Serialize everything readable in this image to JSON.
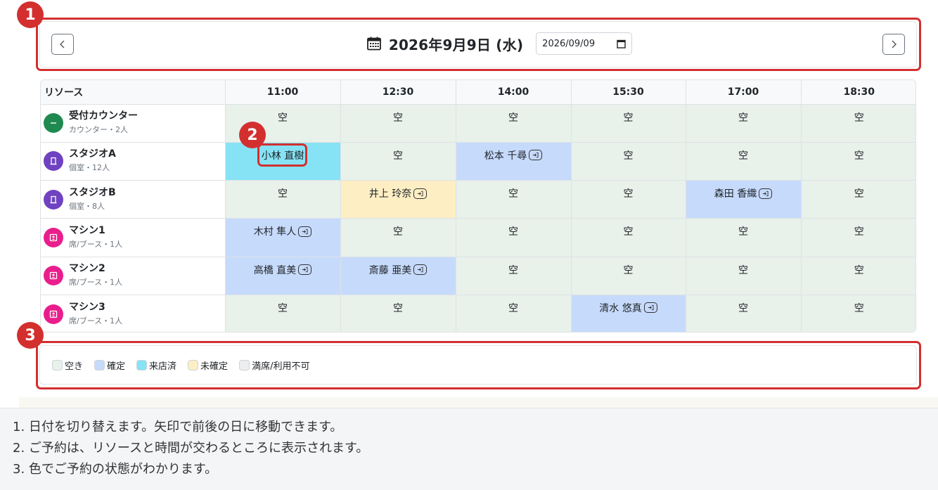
{
  "annotations": [
    "1",
    "2",
    "3"
  ],
  "header": {
    "date_title": "2026年9月9日 (水)",
    "date_value": "2026/09/09"
  },
  "table": {
    "resource_header": "リソース",
    "times": [
      "11:00",
      "12:30",
      "14:00",
      "15:30",
      "17:00",
      "18:30"
    ],
    "rows": [
      {
        "name": "受付カウンター",
        "sub": "カウンター・2人",
        "icon": "counter-icon",
        "color": "#1e8a50",
        "cells": [
          {
            "text": "空",
            "status": "empty"
          },
          {
            "text": "空",
            "status": "empty"
          },
          {
            "text": "空",
            "status": "empty"
          },
          {
            "text": "空",
            "status": "empty"
          },
          {
            "text": "空",
            "status": "empty"
          },
          {
            "text": "空",
            "status": "empty"
          }
        ]
      },
      {
        "name": "スタジオA",
        "sub": "個室・12人",
        "icon": "door-icon",
        "color": "#6f42c1",
        "cells": [
          {
            "text": "小林 直樹",
            "status": "arrived"
          },
          {
            "text": "空",
            "status": "empty"
          },
          {
            "text": "松本 千尋",
            "status": "confirmed"
          },
          {
            "text": "空",
            "status": "empty"
          },
          {
            "text": "空",
            "status": "empty"
          },
          {
            "text": "空",
            "status": "empty"
          }
        ]
      },
      {
        "name": "スタジオB",
        "sub": "個室・8人",
        "icon": "door-icon",
        "color": "#6f42c1",
        "cells": [
          {
            "text": "空",
            "status": "empty"
          },
          {
            "text": "井上 玲奈",
            "status": "pending"
          },
          {
            "text": "空",
            "status": "empty"
          },
          {
            "text": "空",
            "status": "empty"
          },
          {
            "text": "森田 香織",
            "status": "confirmed"
          },
          {
            "text": "空",
            "status": "empty"
          }
        ]
      },
      {
        "name": "マシン1",
        "sub": "席/ブース・1人",
        "icon": "booth-icon",
        "color": "#e91e8c",
        "cells": [
          {
            "text": "木村 隼人",
            "status": "confirmed"
          },
          {
            "text": "空",
            "status": "empty"
          },
          {
            "text": "空",
            "status": "empty"
          },
          {
            "text": "空",
            "status": "empty"
          },
          {
            "text": "空",
            "status": "empty"
          },
          {
            "text": "空",
            "status": "empty"
          }
        ]
      },
      {
        "name": "マシン2",
        "sub": "席/ブース・1人",
        "icon": "booth-icon",
        "color": "#e91e8c",
        "cells": [
          {
            "text": "高橋 直美",
            "status": "confirmed"
          },
          {
            "text": "斎藤 亜美",
            "status": "confirmed"
          },
          {
            "text": "空",
            "status": "empty"
          },
          {
            "text": "空",
            "status": "empty"
          },
          {
            "text": "空",
            "status": "empty"
          },
          {
            "text": "空",
            "status": "empty"
          }
        ]
      },
      {
        "name": "マシン3",
        "sub": "席/ブース・1人",
        "icon": "booth-icon",
        "color": "#e91e8c",
        "cells": [
          {
            "text": "空",
            "status": "empty"
          },
          {
            "text": "空",
            "status": "empty"
          },
          {
            "text": "空",
            "status": "empty"
          },
          {
            "text": "清水 悠真",
            "status": "confirmed"
          },
          {
            "text": "空",
            "status": "empty"
          },
          {
            "text": "空",
            "status": "empty"
          }
        ]
      }
    ]
  },
  "legend": [
    {
      "label": "空き",
      "color": "#e8f1ea"
    },
    {
      "label": "確定",
      "color": "#c6dafc"
    },
    {
      "label": "来店済",
      "color": "#86e3f5"
    },
    {
      "label": "未確定",
      "color": "#fdeec4"
    },
    {
      "label": "満席/利用不可",
      "color": "#eceeef"
    }
  ],
  "notes": [
    "1. 日付を切り替えます。矢印で前後の日に移動できます。",
    "2. ご予約は、リソースと時間が交わるところに表示されます。",
    "3. 色でご予約の状態がわかります。"
  ]
}
